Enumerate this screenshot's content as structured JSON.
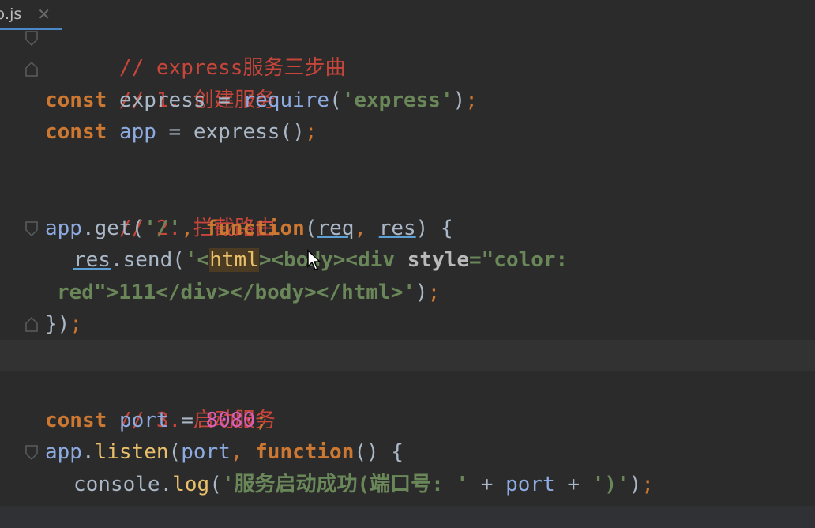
{
  "tab": {
    "label": "p.js",
    "close_glyph": "✕"
  },
  "code_lines": [
    {
      "text": "// express服务三步曲"
    },
    {
      "text": "// 1. 创建服务"
    },
    {
      "text": "const express = require('express');"
    },
    {
      "text": "const app = express();"
    },
    {
      "text": ""
    },
    {
      "text": "// 2. 拦截路由"
    },
    {
      "text": "app.get('/', function(req, res) {"
    },
    {
      "text": "  res.send('<html><body><div style=\"color:"
    },
    {
      "text": "red\">111</div></body></html>');"
    },
    {
      "text": "});"
    },
    {
      "text": ""
    },
    {
      "text": "// 3. 启动服务"
    },
    {
      "text": "const port = 8080;"
    },
    {
      "text": "app.listen(port, function() {"
    },
    {
      "text": "  console.log('服务启动成功(端口号: ' + port + ')');"
    }
  ],
  "tokens": {
    "l0": [
      "// express服务三步曲"
    ],
    "l1": [
      "// 1. 创建服务"
    ],
    "l2": [
      "const",
      " express ",
      "=",
      " ",
      "require",
      "(",
      "'express'",
      ")",
      ";"
    ],
    "l3": [
      "const",
      " ",
      "app",
      " = ",
      "express",
      "()",
      ";"
    ],
    "l5": [
      "// 2. 拦截路由"
    ],
    "l6": [
      "app",
      ".get(",
      "'/'",
      ",",
      " ",
      "function",
      "(",
      "req",
      ",",
      " ",
      "res",
      ")",
      " {"
    ],
    "l7": [
      "res",
      ".send(",
      "'<",
      "html",
      ">",
      "<body",
      "><",
      "div",
      " ",
      "style",
      "=",
      "\"color:"
    ],
    "l8": [
      "red\"",
      ">111</",
      "div",
      "></",
      "body",
      "></",
      "html",
      ">'",
      ")",
      ";"
    ],
    "l9": [
      "}",
      ")",
      ";"
    ],
    "l11": [
      "// 3. 启动服务"
    ],
    "l12": [
      "const",
      " ",
      "port",
      " = ",
      "8080",
      ";"
    ],
    "l13": [
      "app",
      ".",
      "listen",
      "(",
      "port",
      ",",
      " ",
      "function",
      "()",
      " {"
    ],
    "l14": [
      "console",
      ".",
      "log",
      "(",
      "'服务启动成功(端口号: '",
      " + ",
      "port",
      " + ",
      "')'",
      ")",
      ";"
    ]
  },
  "colors": {
    "background": "#2b2b2b",
    "comment": "#c8453a",
    "keyword": "#cc7832",
    "string": "#6a8759",
    "number": "#d75fb5",
    "identifier": "#8dabe0",
    "tab_underline": "#4a88c7"
  },
  "icons": {
    "fold": "fold-marker-icon",
    "cursor": "mouse-cursor-icon",
    "close": "close-icon"
  }
}
